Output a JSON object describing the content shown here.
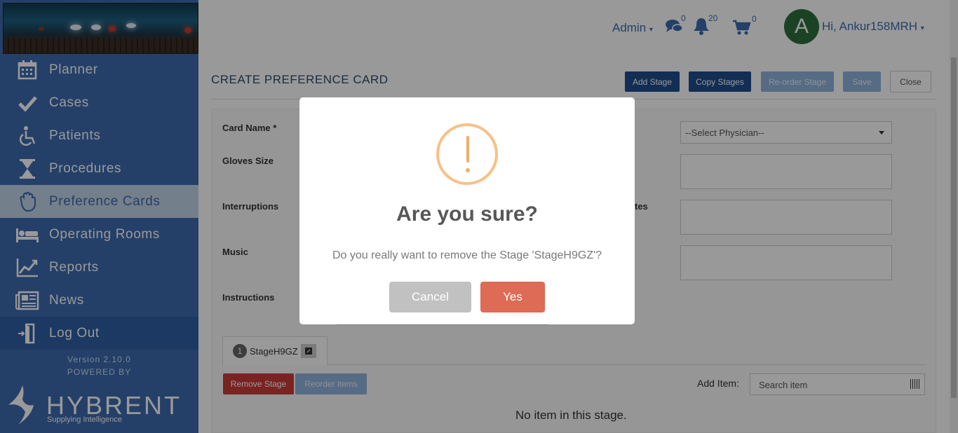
{
  "sidebar": {
    "items": [
      {
        "label": "Planner",
        "icon": "calendar-icon"
      },
      {
        "label": "Cases",
        "icon": "checkmark-icon"
      },
      {
        "label": "Patients",
        "icon": "wheelchair-icon"
      },
      {
        "label": "Procedures",
        "icon": "hourglass-icon"
      },
      {
        "label": "Preference Cards",
        "icon": "glove-icon"
      },
      {
        "label": "Operating Rooms",
        "icon": "bed-icon"
      },
      {
        "label": "Reports",
        "icon": "line-chart-icon"
      },
      {
        "label": "News",
        "icon": "newspaper-icon"
      },
      {
        "label": "Log Out",
        "icon": "door-exit-icon"
      }
    ],
    "version": "Version 2.10.0",
    "powered_by": "POWERED BY",
    "brand": "HYBRENT",
    "brand_tagline": "Supplying Intelligence"
  },
  "header": {
    "admin_label": "Admin",
    "messages_count": "0",
    "notifications_count": "20",
    "cart_count": "0",
    "avatar_letter": "A",
    "greeting": "Hi, Ankur158MRH"
  },
  "page": {
    "title": "CREATE PREFERENCE CARD",
    "buttons": {
      "add_stage": "Add Stage",
      "copy_stages": "Copy Stages",
      "reorder_stage": "Re-order Stage",
      "save": "Save",
      "close": "Close"
    },
    "form": {
      "card_name_label": "Card Name *",
      "gloves_size_label": "Gloves Size",
      "interruptions_label": "Interruptions",
      "music_label": "Music",
      "instructions_label": "Instructions",
      "partial_label": "tes",
      "physician_select": "--Select Physician--"
    },
    "stage_tab": {
      "number": "1",
      "name": "StageH9GZ"
    },
    "remove_stage": "Remove Stage",
    "reorder_items": "Reorder items",
    "add_item_label": "Add Item:",
    "search_placeholder": "Search item",
    "empty_message": "No item in this stage."
  },
  "modal": {
    "title": "Are you sure?",
    "text": "Do you really want to remove the Stage 'StageH9GZ'?",
    "cancel": "Cancel",
    "confirm": "Yes",
    "colors": {
      "cancel": "#c1c1c1",
      "confirm": "#dd6b55",
      "warning": "#f8bb86"
    }
  }
}
